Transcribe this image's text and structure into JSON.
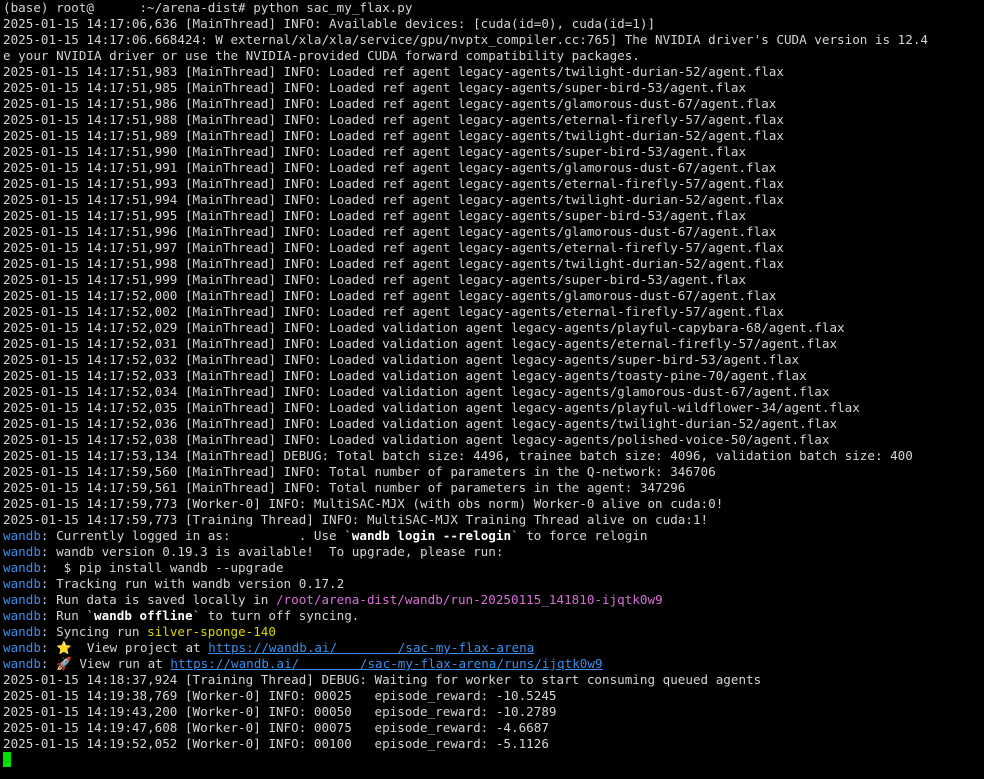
{
  "terminal": {
    "cursor_color": "#00e000",
    "colors": {
      "text": "#d4d4d4",
      "wandb_prefix": "#3b8eea",
      "path": "#d670d6",
      "run_name": "#d7d700",
      "link": "#3b8eea"
    },
    "lines": [
      [
        {
          "t": "(base) root@      :~/arena-dist# python sac_my_flax.py"
        }
      ],
      [
        {
          "t": "2025-01-15 14:17:06,636 [MainThread] INFO: Available devices: [cuda(id=0), cuda(id=1)]"
        }
      ],
      [
        {
          "t": "2025-01-15 14:17:06.668424: W external/xla/xla/service/gpu/nvptx_compiler.cc:765] The NVIDIA driver's CUDA version is 12.4"
        }
      ],
      [
        {
          "t": "e your NVIDIA driver or use the NVIDIA-provided CUDA forward compatibility packages."
        }
      ],
      [
        {
          "t": "2025-01-15 14:17:51,983 [MainThread] INFO: Loaded ref agent legacy-agents/twilight-durian-52/agent.flax"
        }
      ],
      [
        {
          "t": "2025-01-15 14:17:51,985 [MainThread] INFO: Loaded ref agent legacy-agents/super-bird-53/agent.flax"
        }
      ],
      [
        {
          "t": "2025-01-15 14:17:51,986 [MainThread] INFO: Loaded ref agent legacy-agents/glamorous-dust-67/agent.flax"
        }
      ],
      [
        {
          "t": "2025-01-15 14:17:51,988 [MainThread] INFO: Loaded ref agent legacy-agents/eternal-firefly-57/agent.flax"
        }
      ],
      [
        {
          "t": "2025-01-15 14:17:51,989 [MainThread] INFO: Loaded ref agent legacy-agents/twilight-durian-52/agent.flax"
        }
      ],
      [
        {
          "t": "2025-01-15 14:17:51,990 [MainThread] INFO: Loaded ref agent legacy-agents/super-bird-53/agent.flax"
        }
      ],
      [
        {
          "t": "2025-01-15 14:17:51,991 [MainThread] INFO: Loaded ref agent legacy-agents/glamorous-dust-67/agent.flax"
        }
      ],
      [
        {
          "t": "2025-01-15 14:17:51,993 [MainThread] INFO: Loaded ref agent legacy-agents/eternal-firefly-57/agent.flax"
        }
      ],
      [
        {
          "t": "2025-01-15 14:17:51,994 [MainThread] INFO: Loaded ref agent legacy-agents/twilight-durian-52/agent.flax"
        }
      ],
      [
        {
          "t": "2025-01-15 14:17:51,995 [MainThread] INFO: Loaded ref agent legacy-agents/super-bird-53/agent.flax"
        }
      ],
      [
        {
          "t": "2025-01-15 14:17:51,996 [MainThread] INFO: Loaded ref agent legacy-agents/glamorous-dust-67/agent.flax"
        }
      ],
      [
        {
          "t": "2025-01-15 14:17:51,997 [MainThread] INFO: Loaded ref agent legacy-agents/eternal-firefly-57/agent.flax"
        }
      ],
      [
        {
          "t": "2025-01-15 14:17:51,998 [MainThread] INFO: Loaded ref agent legacy-agents/twilight-durian-52/agent.flax"
        }
      ],
      [
        {
          "t": "2025-01-15 14:17:51,999 [MainThread] INFO: Loaded ref agent legacy-agents/super-bird-53/agent.flax"
        }
      ],
      [
        {
          "t": "2025-01-15 14:17:52,000 [MainThread] INFO: Loaded ref agent legacy-agents/glamorous-dust-67/agent.flax"
        }
      ],
      [
        {
          "t": "2025-01-15 14:17:52,002 [MainThread] INFO: Loaded ref agent legacy-agents/eternal-firefly-57/agent.flax"
        }
      ],
      [
        {
          "t": "2025-01-15 14:17:52,029 [MainThread] INFO: Loaded validation agent legacy-agents/playful-capybara-68/agent.flax"
        }
      ],
      [
        {
          "t": "2025-01-15 14:17:52,031 [MainThread] INFO: Loaded validation agent legacy-agents/eternal-firefly-57/agent.flax"
        }
      ],
      [
        {
          "t": "2025-01-15 14:17:52,032 [MainThread] INFO: Loaded validation agent legacy-agents/super-bird-53/agent.flax"
        }
      ],
      [
        {
          "t": "2025-01-15 14:17:52,033 [MainThread] INFO: Loaded validation agent legacy-agents/toasty-pine-70/agent.flax"
        }
      ],
      [
        {
          "t": "2025-01-15 14:17:52,034 [MainThread] INFO: Loaded validation agent legacy-agents/glamorous-dust-67/agent.flax"
        }
      ],
      [
        {
          "t": "2025-01-15 14:17:52,035 [MainThread] INFO: Loaded validation agent legacy-agents/playful-wildflower-34/agent.flax"
        }
      ],
      [
        {
          "t": "2025-01-15 14:17:52,036 [MainThread] INFO: Loaded validation agent legacy-agents/twilight-durian-52/agent.flax"
        }
      ],
      [
        {
          "t": "2025-01-15 14:17:52,038 [MainThread] INFO: Loaded validation agent legacy-agents/polished-voice-50/agent.flax"
        }
      ],
      [
        {
          "t": "2025-01-15 14:17:53,134 [MainThread] DEBUG: Total batch size: 4496, trainee batch size: 4096, validation batch size: 400"
        }
      ],
      [
        {
          "t": "2025-01-15 14:17:59,560 [MainThread] INFO: Total number of parameters in the Q-network: 346706"
        }
      ],
      [
        {
          "t": "2025-01-15 14:17:59,561 [MainThread] INFO: Total number of parameters in the agent: 347296"
        }
      ],
      [
        {
          "t": "2025-01-15 14:17:59,773 [Worker-0] INFO: MultiSAC-MJX (with obs norm) Worker-0 alive on cuda:0!"
        }
      ],
      [
        {
          "t": "2025-01-15 14:17:59,773 [Training Thread] INFO: MultiSAC-MJX Training Thread alive on cuda:1!"
        }
      ],
      [
        {
          "t": "wandb",
          "c": "wandb"
        },
        {
          "t": ": Currently logged in as:         . Use `"
        },
        {
          "t": "wandb login --relogin",
          "c": "bold"
        },
        {
          "t": "` to force relogin"
        }
      ],
      [
        {
          "t": "wandb",
          "c": "wandb"
        },
        {
          "t": ": wandb version 0.19.3 is available!  To upgrade, please run:"
        }
      ],
      [
        {
          "t": "wandb",
          "c": "wandb"
        },
        {
          "t": ":  $ pip install wandb --upgrade"
        }
      ],
      [
        {
          "t": "wandb",
          "c": "wandb"
        },
        {
          "t": ": Tracking run with wandb version 0.17.2"
        }
      ],
      [
        {
          "t": "wandb",
          "c": "wandb"
        },
        {
          "t": ": Run data is saved locally in "
        },
        {
          "t": "/root/arena-dist/wandb/run-20250115_141810-ijqtk0w9",
          "c": "path"
        }
      ],
      [
        {
          "t": "wandb",
          "c": "wandb"
        },
        {
          "t": ": Run `"
        },
        {
          "t": "wandb offline",
          "c": "bold"
        },
        {
          "t": "` to turn off syncing."
        }
      ],
      [
        {
          "t": "wandb",
          "c": "wandb"
        },
        {
          "t": ": Syncing run "
        },
        {
          "t": "silver-sponge-140",
          "c": "run"
        }
      ],
      [
        {
          "t": "wandb",
          "c": "wandb"
        },
        {
          "t": ": ⭐  View project at "
        },
        {
          "t": "https://wandb.ai/        /sac-my-flax-arena",
          "c": "link"
        }
      ],
      [
        {
          "t": "wandb",
          "c": "wandb"
        },
        {
          "t": ": 🚀 View run at "
        },
        {
          "t": "https://wandb.ai/        /sac-my-flax-arena/runs/ijqtk0w9",
          "c": "link"
        }
      ],
      [
        {
          "t": "2025-01-15 14:18:37,924 [Training Thread] DEBUG: Waiting for worker to start consuming queued agents"
        }
      ],
      [
        {
          "t": "2025-01-15 14:19:38,769 [Worker-0] INFO: 00025   episode_reward: -10.5245"
        }
      ],
      [
        {
          "t": "2025-01-15 14:19:43,200 [Worker-0] INFO: 00050   episode_reward: -10.2789"
        }
      ],
      [
        {
          "t": "2025-01-15 14:19:47,608 [Worker-0] INFO: 00075   episode_reward: -4.6687"
        }
      ],
      [
        {
          "t": "2025-01-15 14:19:52,052 [Worker-0] INFO: 00100   episode_reward: -5.1126"
        }
      ]
    ]
  }
}
